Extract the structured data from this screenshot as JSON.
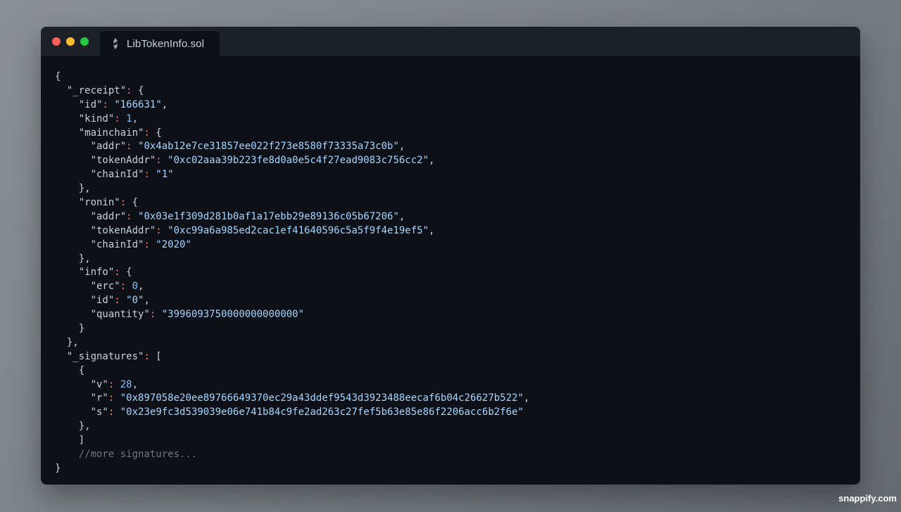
{
  "window": {
    "tab_title": "LibTokenInfo.sol",
    "tab_icon": "solidity-icon"
  },
  "code_lines": [
    {
      "indent": 0,
      "tokens": [
        {
          "t": "punct",
          "v": "{"
        }
      ]
    },
    {
      "indent": 1,
      "tokens": [
        {
          "t": "key",
          "v": "\"_receipt\""
        },
        {
          "t": "colon",
          "v": ":"
        },
        {
          "t": "punct",
          "v": " {"
        }
      ]
    },
    {
      "indent": 2,
      "tokens": [
        {
          "t": "key",
          "v": "\"id\""
        },
        {
          "t": "colon",
          "v": ":"
        },
        {
          "t": "str",
          "v": " \"166631\""
        },
        {
          "t": "punct",
          "v": ","
        }
      ]
    },
    {
      "indent": 2,
      "tokens": [
        {
          "t": "key",
          "v": "\"kind\""
        },
        {
          "t": "colon",
          "v": ":"
        },
        {
          "t": "num",
          "v": " 1"
        },
        {
          "t": "punct",
          "v": ","
        }
      ]
    },
    {
      "indent": 2,
      "tokens": [
        {
          "t": "key",
          "v": "\"mainchain\""
        },
        {
          "t": "colon",
          "v": ":"
        },
        {
          "t": "punct",
          "v": " {"
        }
      ]
    },
    {
      "indent": 3,
      "tokens": [
        {
          "t": "key",
          "v": "\"addr\""
        },
        {
          "t": "colon",
          "v": ":"
        },
        {
          "t": "str",
          "v": " \"0x4ab12e7ce31857ee022f273e8580f73335a73c0b\""
        },
        {
          "t": "punct",
          "v": ","
        }
      ]
    },
    {
      "indent": 3,
      "tokens": [
        {
          "t": "key",
          "v": "\"tokenAddr\""
        },
        {
          "t": "colon",
          "v": ":"
        },
        {
          "t": "str",
          "v": " \"0xc02aaa39b223fe8d0a0e5c4f27ead9083c756cc2\""
        },
        {
          "t": "punct",
          "v": ","
        }
      ]
    },
    {
      "indent": 3,
      "tokens": [
        {
          "t": "key",
          "v": "\"chainId\""
        },
        {
          "t": "colon",
          "v": ":"
        },
        {
          "t": "str",
          "v": " \"1\""
        }
      ]
    },
    {
      "indent": 2,
      "tokens": [
        {
          "t": "punct",
          "v": "},"
        }
      ]
    },
    {
      "indent": 2,
      "tokens": [
        {
          "t": "key",
          "v": "\"ronin\""
        },
        {
          "t": "colon",
          "v": ":"
        },
        {
          "t": "punct",
          "v": " {"
        }
      ]
    },
    {
      "indent": 3,
      "tokens": [
        {
          "t": "key",
          "v": "\"addr\""
        },
        {
          "t": "colon",
          "v": ":"
        },
        {
          "t": "str",
          "v": " \"0x03e1f309d281b0af1a17ebb29e89136c05b67206\""
        },
        {
          "t": "punct",
          "v": ","
        }
      ]
    },
    {
      "indent": 3,
      "tokens": [
        {
          "t": "key",
          "v": "\"tokenAddr\""
        },
        {
          "t": "colon",
          "v": ":"
        },
        {
          "t": "str",
          "v": " \"0xc99a6a985ed2cac1ef41640596c5a5f9f4e19ef5\""
        },
        {
          "t": "punct",
          "v": ","
        }
      ]
    },
    {
      "indent": 3,
      "tokens": [
        {
          "t": "key",
          "v": "\"chainId\""
        },
        {
          "t": "colon",
          "v": ":"
        },
        {
          "t": "str",
          "v": " \"2020\""
        }
      ]
    },
    {
      "indent": 2,
      "tokens": [
        {
          "t": "punct",
          "v": "},"
        }
      ]
    },
    {
      "indent": 2,
      "tokens": [
        {
          "t": "key",
          "v": "\"info\""
        },
        {
          "t": "colon",
          "v": ":"
        },
        {
          "t": "punct",
          "v": " {"
        }
      ]
    },
    {
      "indent": 3,
      "tokens": [
        {
          "t": "key",
          "v": "\"erc\""
        },
        {
          "t": "colon",
          "v": ":"
        },
        {
          "t": "num",
          "v": " 0"
        },
        {
          "t": "punct",
          "v": ","
        }
      ]
    },
    {
      "indent": 3,
      "tokens": [
        {
          "t": "key",
          "v": "\"id\""
        },
        {
          "t": "colon",
          "v": ":"
        },
        {
          "t": "str",
          "v": " \"0\""
        },
        {
          "t": "punct",
          "v": ","
        }
      ]
    },
    {
      "indent": 3,
      "tokens": [
        {
          "t": "key",
          "v": "\"quantity\""
        },
        {
          "t": "colon",
          "v": ":"
        },
        {
          "t": "str",
          "v": " \"3996093750000000000000\""
        }
      ]
    },
    {
      "indent": 2,
      "tokens": [
        {
          "t": "punct",
          "v": "}"
        }
      ]
    },
    {
      "indent": 1,
      "tokens": [
        {
          "t": "punct",
          "v": "},"
        }
      ]
    },
    {
      "indent": 1,
      "tokens": [
        {
          "t": "key",
          "v": "\"_signatures\""
        },
        {
          "t": "colon",
          "v": ":"
        },
        {
          "t": "punct",
          "v": " ["
        }
      ]
    },
    {
      "indent": 2,
      "tokens": [
        {
          "t": "punct",
          "v": "{"
        }
      ]
    },
    {
      "indent": 3,
      "tokens": [
        {
          "t": "key",
          "v": "\"v\""
        },
        {
          "t": "colon",
          "v": ":"
        },
        {
          "t": "num",
          "v": " 28"
        },
        {
          "t": "punct",
          "v": ","
        }
      ]
    },
    {
      "indent": 3,
      "tokens": [
        {
          "t": "key",
          "v": "\"r\""
        },
        {
          "t": "colon",
          "v": ":"
        },
        {
          "t": "str",
          "v": " \"0x897058e20ee89766649370ec29a43ddef9543d3923488eecaf6b04c26627b522\""
        },
        {
          "t": "punct",
          "v": ","
        }
      ]
    },
    {
      "indent": 3,
      "tokens": [
        {
          "t": "key",
          "v": "\"s\""
        },
        {
          "t": "colon",
          "v": ":"
        },
        {
          "t": "str",
          "v": " \"0x23e9fc3d539039e06e741b84c9fe2ad263c27fef5b63e85e86f2206acc6b2f6e\""
        }
      ]
    },
    {
      "indent": 2,
      "tokens": [
        {
          "t": "punct",
          "v": "},"
        }
      ]
    },
    {
      "indent": 2,
      "tokens": [
        {
          "t": "punct",
          "v": "]"
        }
      ]
    },
    {
      "indent": 2,
      "tokens": [
        {
          "t": "comment",
          "v": "//more signatures..."
        }
      ]
    },
    {
      "indent": 0,
      "tokens": [
        {
          "t": "punct",
          "v": "}"
        }
      ]
    }
  ],
  "watermark": "snappify.com",
  "colors": {
    "background": "#0d1117",
    "titlebar": "#1c2027",
    "string": "#a5d6ff",
    "number": "#79c0ff",
    "colon": "#ff7b72",
    "comment": "#6e7681"
  }
}
